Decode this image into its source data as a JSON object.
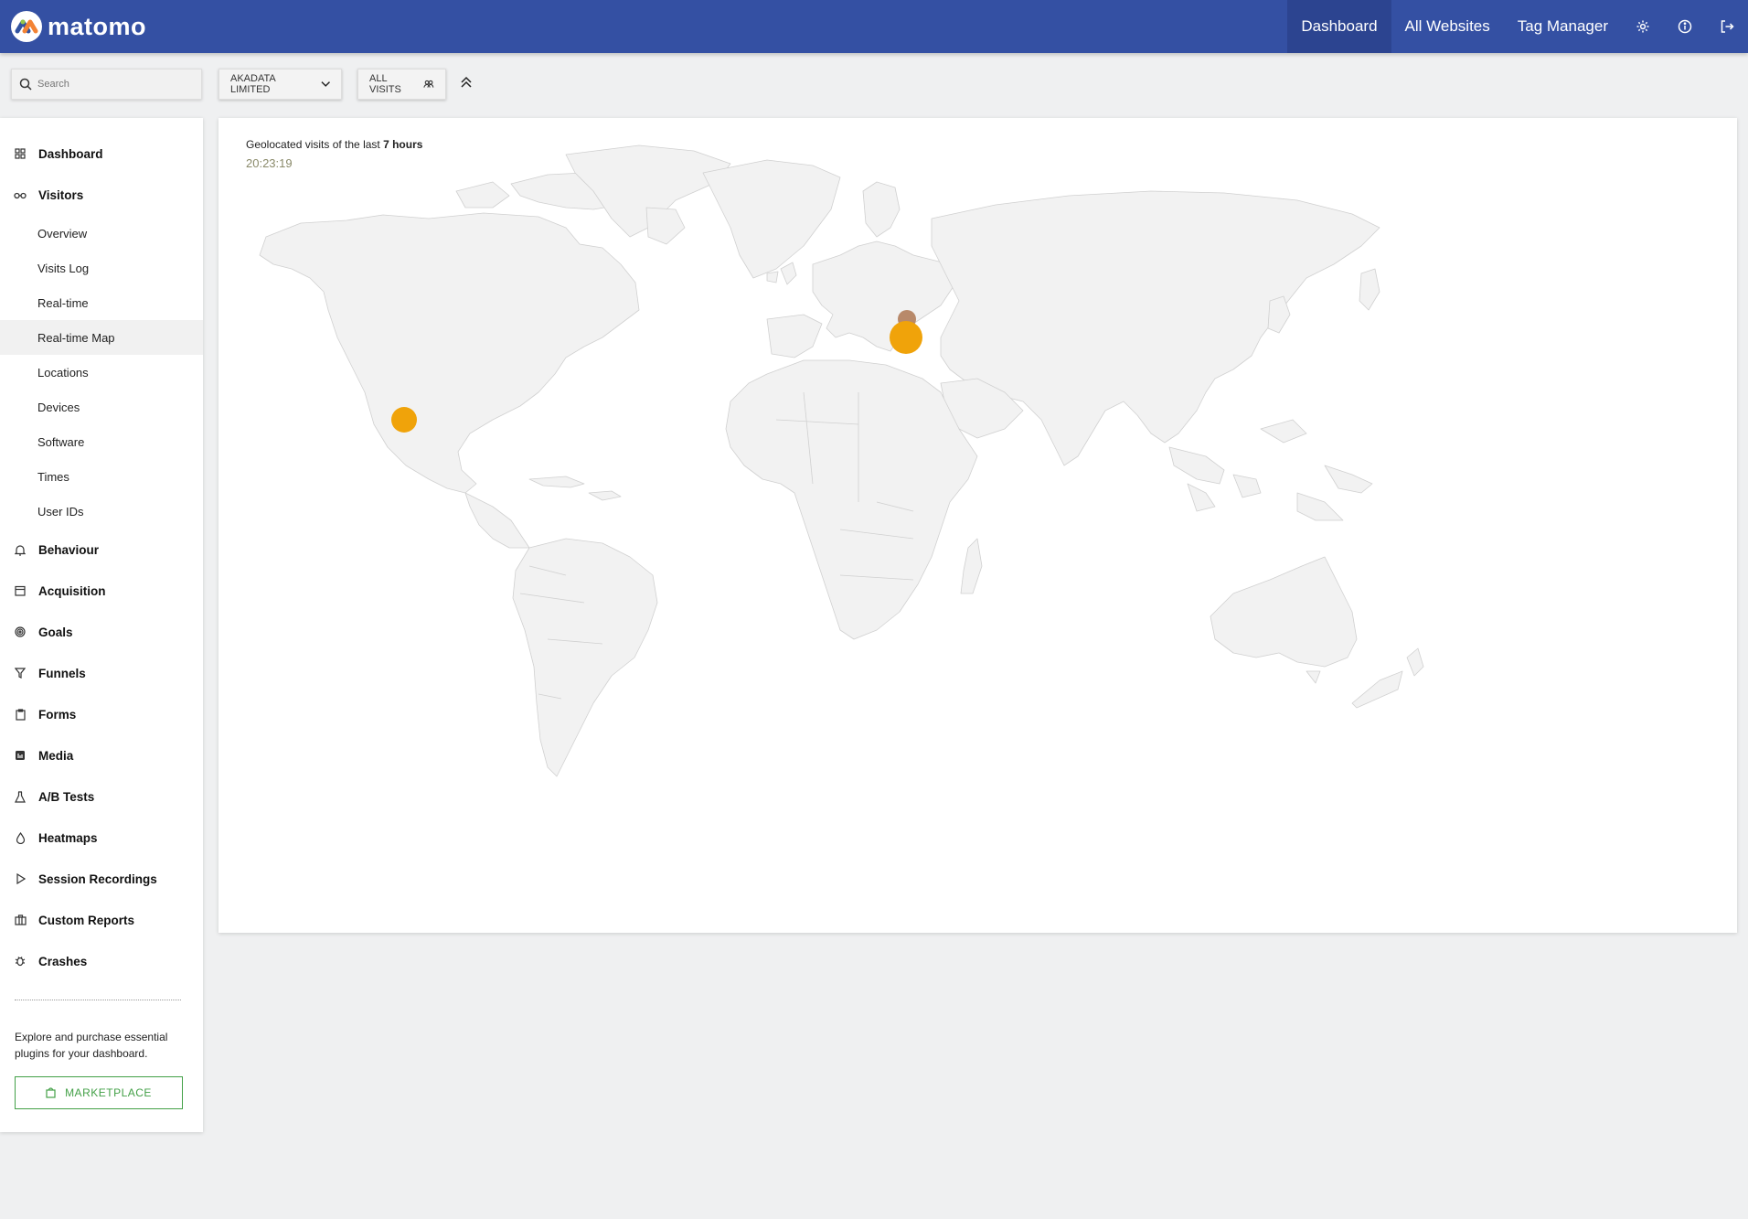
{
  "header": {
    "logo_text": "matomo",
    "nav": [
      {
        "label": "Dashboard",
        "active": true
      },
      {
        "label": "All Websites",
        "active": false
      },
      {
        "label": "Tag Manager",
        "active": false
      }
    ],
    "icons": [
      "gear-icon",
      "info-icon",
      "logout-icon"
    ]
  },
  "filters": {
    "search_placeholder": "Search",
    "site_selector": "AKADATA LIMITED",
    "segment_selector": "ALL VISITS"
  },
  "sidebar": {
    "categories": [
      {
        "label": "Dashboard",
        "icon": "grid-icon"
      },
      {
        "label": "Visitors",
        "icon": "glasses-icon"
      },
      {
        "label": "Behaviour",
        "icon": "bell-icon"
      },
      {
        "label": "Acquisition",
        "icon": "calendar-icon"
      },
      {
        "label": "Goals",
        "icon": "target-icon"
      },
      {
        "label": "Funnels",
        "icon": "funnel-icon"
      },
      {
        "label": "Forms",
        "icon": "clipboard-icon"
      },
      {
        "label": "Media",
        "icon": "media-icon"
      },
      {
        "label": "A/B Tests",
        "icon": "flask-icon"
      },
      {
        "label": "Heatmaps",
        "icon": "drop-icon"
      },
      {
        "label": "Session Recordings",
        "icon": "play-icon"
      },
      {
        "label": "Custom Reports",
        "icon": "briefcase-icon"
      },
      {
        "label": "Crashes",
        "icon": "bug-icon"
      }
    ],
    "visitor_items": [
      {
        "label": "Overview",
        "active": false
      },
      {
        "label": "Visits Log",
        "active": false
      },
      {
        "label": "Real-time",
        "active": false
      },
      {
        "label": "Real-time Map",
        "active": true
      },
      {
        "label": "Locations",
        "active": false
      },
      {
        "label": "Devices",
        "active": false
      },
      {
        "label": "Software",
        "active": false
      },
      {
        "label": "Times",
        "active": false
      },
      {
        "label": "User IDs",
        "active": false
      }
    ],
    "marketplace_text": "Explore and purchase essential plugins for your dashboard.",
    "marketplace_button": "MARKETPLACE"
  },
  "main": {
    "title_prefix": "Geolocated visits of the last",
    "title_bold": "7 hours",
    "time": "20:23:19"
  },
  "colors": {
    "header_bg": "#3450a3",
    "visit_dot": "#f0a30a",
    "visit_dot_old": "#b8896a",
    "land": "#f2f2f2",
    "marketplace_green": "#43a047"
  }
}
